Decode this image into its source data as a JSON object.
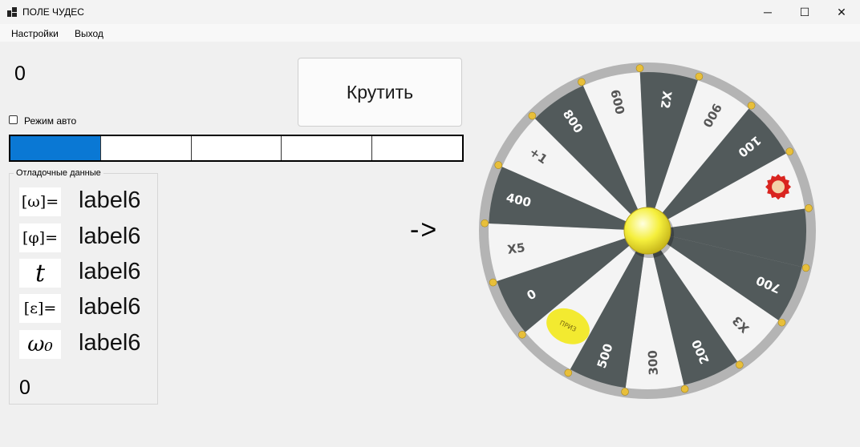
{
  "window": {
    "title": "ПОЛЕ ЧУДЕС",
    "minimize_glyph": "─",
    "maximize_glyph": "☐",
    "close_glyph": "✕"
  },
  "menu": {
    "settings": "Настройки",
    "exit": "Выход"
  },
  "score": "0",
  "spin_button": "Крутить",
  "auto_mode": {
    "label": "Режим авто",
    "checked": false
  },
  "progress": {
    "segments": 5,
    "filled": 1
  },
  "debug": {
    "title": "Отладочные данные",
    "formulas": [
      {
        "symbol": "[ω]=",
        "value": "label6"
      },
      {
        "symbol": "[φ]=",
        "value": "label6"
      },
      {
        "symbol": "t",
        "value": "label6"
      },
      {
        "symbol": "[ε]=",
        "value": "label6"
      },
      {
        "symbol": "ω₀",
        "value": "label6"
      }
    ],
    "counter": "0"
  },
  "pointer": "->",
  "wheel": {
    "colors": {
      "dark": "#525a5b",
      "light": "#f4f4f4",
      "rim": "#b4b4b4",
      "peg": "#e8bf3a",
      "hub": "#f5ef3c"
    },
    "sectors": [
      {
        "label": "900",
        "shade": "light"
      },
      {
        "label": "100",
        "shade": "dark"
      },
      {
        "label": "",
        "icon": "stop-hand-badge",
        "shade": "light"
      },
      {
        "label": "",
        "shade": "dark"
      },
      {
        "label": "700",
        "shade": "dark"
      },
      {
        "label": "X3",
        "shade": "light"
      },
      {
        "label": "200",
        "shade": "dark"
      },
      {
        "label": "300",
        "shade": "light"
      },
      {
        "label": "500",
        "shade": "dark"
      },
      {
        "label": "",
        "icon": "prize-badge",
        "badge_text": "ПРИЗ",
        "shade": "light"
      },
      {
        "label": "0",
        "shade": "dark"
      },
      {
        "label": "X5",
        "shade": "light"
      },
      {
        "label": "400",
        "shade": "dark"
      },
      {
        "label": "+1",
        "shade": "light"
      },
      {
        "label": "800",
        "shade": "dark"
      },
      {
        "label": "600",
        "shade": "light"
      },
      {
        "label": "X2",
        "shade": "dark"
      }
    ]
  }
}
